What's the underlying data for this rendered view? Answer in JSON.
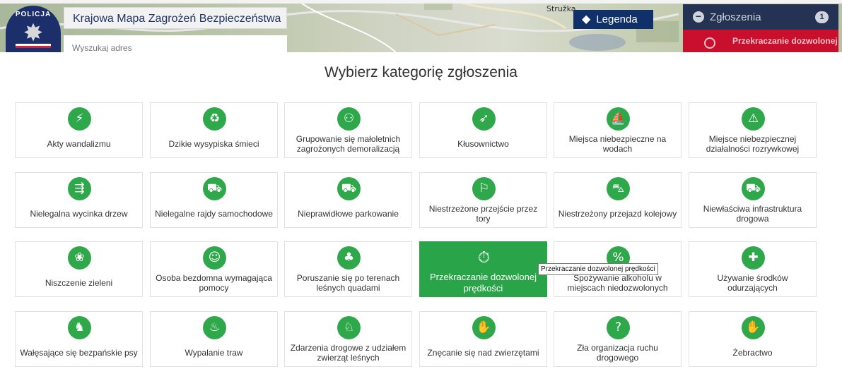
{
  "map": {
    "labels": [
      "Stružka"
    ]
  },
  "header": {
    "logo_text": "POLICJA",
    "title_light": "Krajowa Mapa",
    "title_strong": "Zagrożeń Bezpieczeństwa",
    "search_placeholder": "Wyszukaj adres"
  },
  "legend": {
    "label": "Legenda",
    "icon": "layers-icon"
  },
  "reports": {
    "title": "Zgłoszenia",
    "count": "1",
    "item": "Przekraczanie dozwolonej"
  },
  "modal": {
    "title": "Wybierz kategorię zgłoszenia"
  },
  "categories": [
    {
      "label": "Akty wandalizmu",
      "icon": "vandalism-icon",
      "glyph": "⚡"
    },
    {
      "label": "Dzikie wysypiska śmieci",
      "icon": "trash-icon",
      "glyph": "♻"
    },
    {
      "label": "Grupowanie się małoletnich zagrożonych demoralizacją",
      "icon": "group-icon",
      "glyph": "⚇"
    },
    {
      "label": "Kłusownictwo",
      "icon": "poaching-icon",
      "glyph": "➶"
    },
    {
      "label": "Miejsca niebezpieczne na wodach",
      "icon": "water-danger-icon",
      "glyph": "⛵"
    },
    {
      "label": "Miejsce niebezpiecznej działalności rozrywkowej",
      "icon": "warning-icon",
      "glyph": "⚠"
    },
    {
      "label": "Nielegalna wycinka drzew",
      "icon": "tree-cutting-icon",
      "glyph": "⇶"
    },
    {
      "label": "Nielegalne rajdy samochodowe",
      "icon": "car-race-icon",
      "glyph": "⛟"
    },
    {
      "label": "Nieprawidłowe parkowanie",
      "icon": "parking-icon",
      "glyph": "⛟"
    },
    {
      "label": "Niestrzeżone przejście przez tory",
      "icon": "rail-crossing-icon",
      "glyph": "⚐"
    },
    {
      "label": "Niestrzeżony przejazd kolejowy",
      "icon": "train-icon",
      "glyph": "⛍"
    },
    {
      "label": "Niewłaściwa infrastruktura drogowa",
      "icon": "road-infra-icon",
      "glyph": "⛟"
    },
    {
      "label": "Niszczenie zieleni",
      "icon": "greenery-icon",
      "glyph": "❀"
    },
    {
      "label": "Osoba bezdomna wymagająca pomocy",
      "icon": "homeless-icon",
      "glyph": "☺"
    },
    {
      "label": "Poruszanie się po terenach leśnych quadami",
      "icon": "quad-icon",
      "glyph": "♣"
    },
    {
      "label": "Przekraczanie dozwolonej prędkości",
      "icon": "speedometer-icon",
      "glyph": "⏱"
    },
    {
      "label": "Spożywanie alkoholu w miejscach niedozwolonych",
      "icon": "alcohol-icon",
      "glyph": "%"
    },
    {
      "label": "Używanie środków odurzających",
      "icon": "drugs-icon",
      "glyph": "✚"
    },
    {
      "label": "Wałęsające się bezpańskie psy",
      "icon": "dog-icon",
      "glyph": "♞"
    },
    {
      "label": "Wypalanie traw",
      "icon": "fire-icon",
      "glyph": "♨"
    },
    {
      "label": "Zdarzenia drogowe z udziałem zwierząt leśnych",
      "icon": "deer-icon",
      "glyph": "♘"
    },
    {
      "label": "Znęcanie się nad zwierzętami",
      "icon": "animal-abuse-icon",
      "glyph": "✋"
    },
    {
      "label": "Zła organizacja ruchu drogowego",
      "icon": "traffic-icon",
      "glyph": "?"
    },
    {
      "label": "Żebractwo",
      "icon": "begging-icon",
      "glyph": "✋"
    }
  ],
  "selected_category_index": 15,
  "tooltip": "Przekraczanie dozwolonej prędkości",
  "colors": {
    "green": "#2ea84a",
    "navy": "#10306a",
    "red": "#c8102e"
  }
}
